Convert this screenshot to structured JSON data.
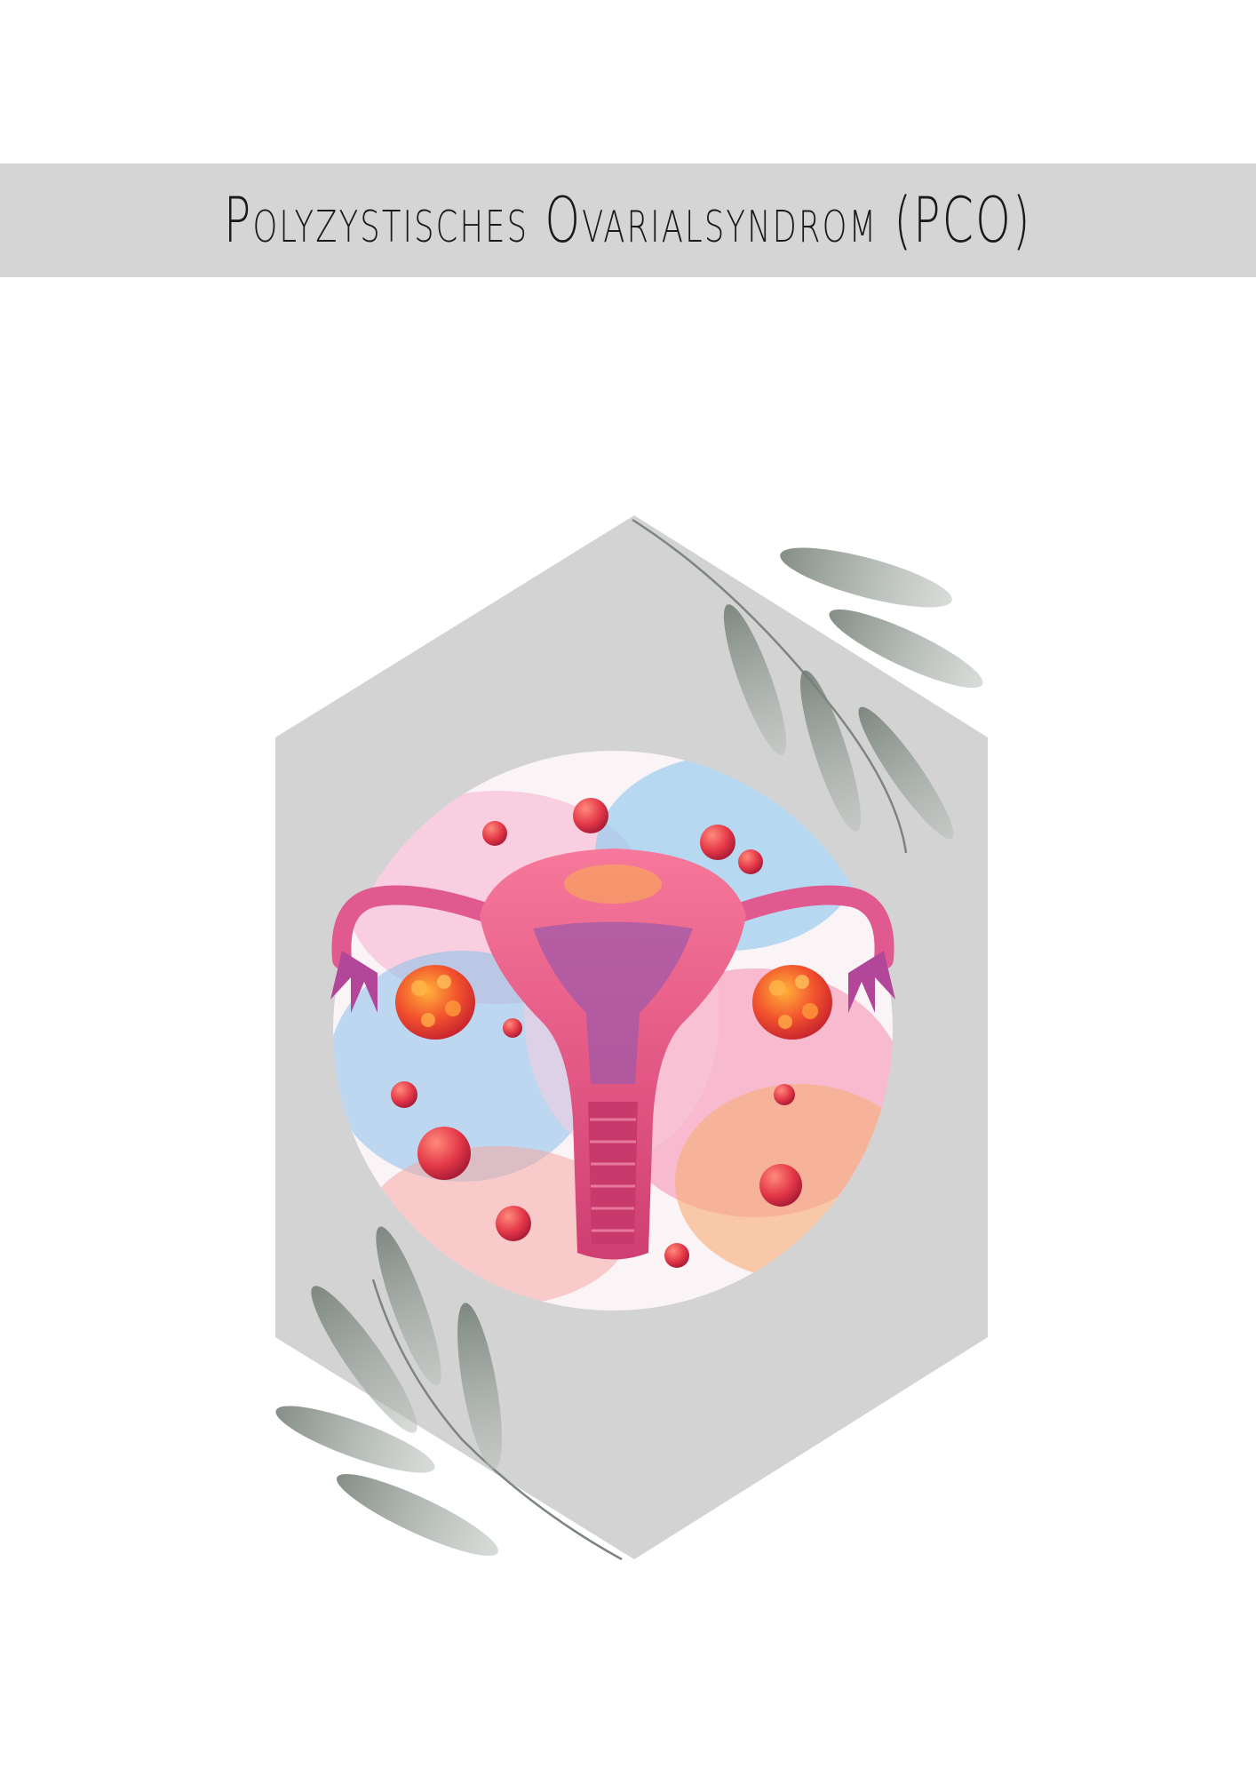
{
  "document": {
    "title": "Polyzystisches Ovarialsyndrom (PCO)"
  },
  "colors": {
    "background": "#ffffff",
    "title_band": "#d5d5d5",
    "hexagon": "#d3d3d3",
    "title_text": "#1a1a1a",
    "leaf": "#8a938c"
  },
  "illustration": {
    "icon": "uterus-ovaries-watercolor-icon"
  }
}
